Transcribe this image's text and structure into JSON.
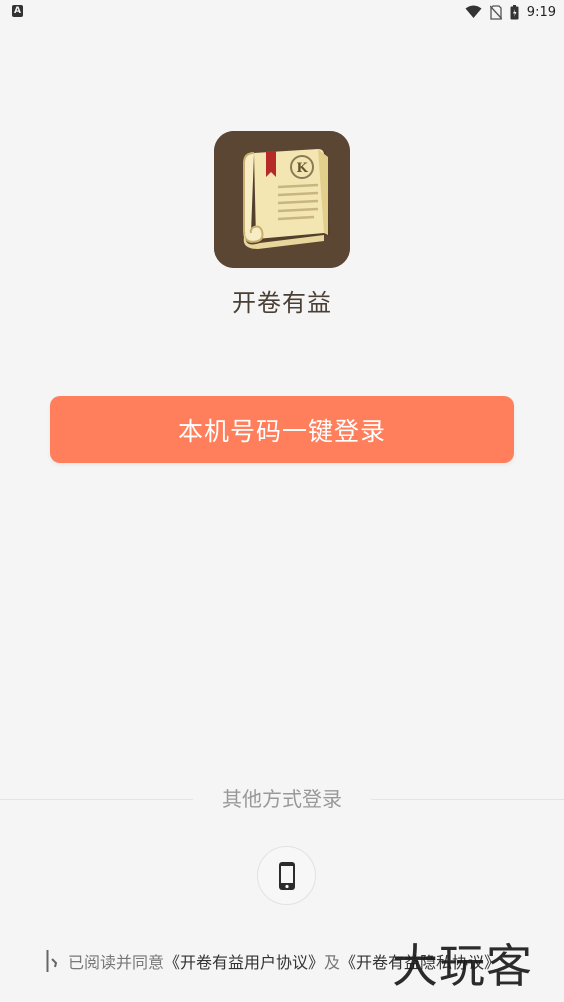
{
  "status_bar": {
    "left_indicator": "A",
    "time": "9:19",
    "icons": [
      "wifi-icon",
      "no-sim-icon",
      "battery-icon"
    ]
  },
  "app": {
    "name": "开卷有益",
    "logo_letter": "K",
    "colors": {
      "icon_bg": "#5a4632",
      "bookmark": "#b52a26",
      "page": "#f3e6b3"
    }
  },
  "login": {
    "one_click_label": "本机号码一键登录",
    "button_color": "#ff7f5c"
  },
  "other_login": {
    "label": "其他方式登录",
    "phone_icon": "mobile-phone-icon"
  },
  "agreement": {
    "prefix": "已阅读并同意",
    "user_agreement": "《开卷有益用户协议》",
    "conjunction": "及",
    "privacy_policy": "《开卷有益隐私协议》"
  },
  "watermark": {
    "text": "大玩客"
  }
}
